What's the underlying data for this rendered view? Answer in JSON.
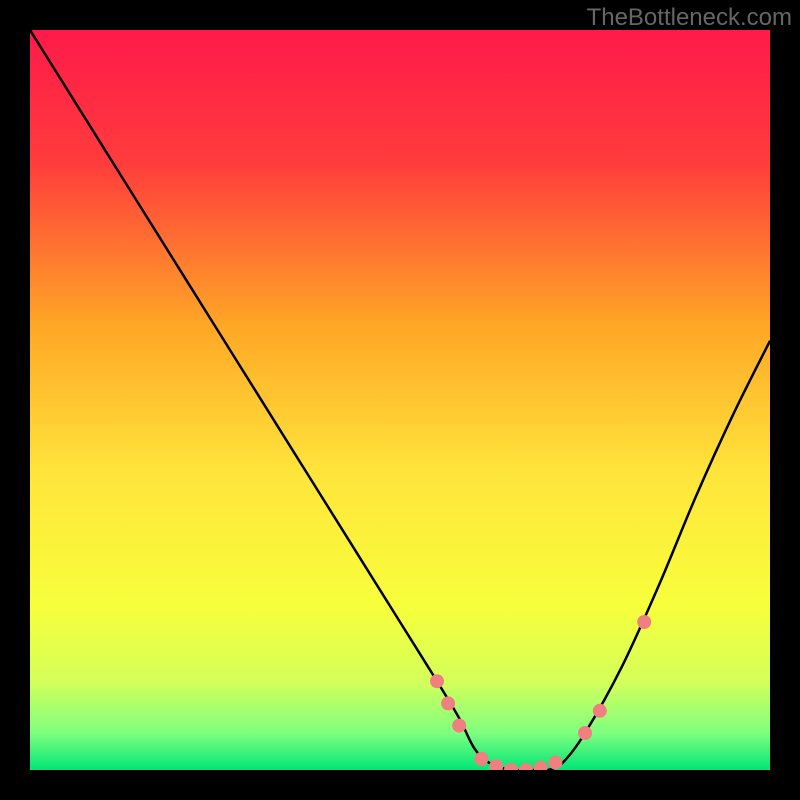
{
  "watermark": "TheBottleneck.com",
  "chart_data": {
    "type": "line",
    "title": "",
    "xlabel": "",
    "ylabel": "",
    "xlim": [
      0,
      100
    ],
    "ylim": [
      0,
      100
    ],
    "background_gradient": {
      "stops": [
        {
          "offset": 0,
          "color": "#ff1a4a"
        },
        {
          "offset": 18,
          "color": "#ff3c3c"
        },
        {
          "offset": 40,
          "color": "#ffa726"
        },
        {
          "offset": 60,
          "color": "#ffe53b"
        },
        {
          "offset": 78,
          "color": "#f7ff3b"
        },
        {
          "offset": 88,
          "color": "#d4ff5a"
        },
        {
          "offset": 95,
          "color": "#7fff7f"
        },
        {
          "offset": 100,
          "color": "#00e676"
        }
      ]
    },
    "series": [
      {
        "name": "bottleneck-curve",
        "x": [
          0,
          5,
          10,
          15,
          20,
          25,
          30,
          35,
          40,
          45,
          50,
          55,
          58,
          60,
          62,
          65,
          68,
          70,
          72,
          75,
          80,
          85,
          90,
          95,
          100
        ],
        "y": [
          100,
          92,
          84,
          76,
          68,
          60,
          52,
          44,
          36,
          28,
          20,
          12,
          7,
          3,
          1,
          0,
          0,
          0,
          1,
          5,
          14,
          25,
          37,
          48,
          58
        ]
      }
    ],
    "markers": {
      "name": "highlight-points",
      "color": "#f08080",
      "points": [
        {
          "x": 55,
          "y": 12
        },
        {
          "x": 56.5,
          "y": 9
        },
        {
          "x": 58,
          "y": 6
        },
        {
          "x": 61,
          "y": 1.5
        },
        {
          "x": 63,
          "y": 0.5
        },
        {
          "x": 65,
          "y": 0
        },
        {
          "x": 67,
          "y": 0
        },
        {
          "x": 69,
          "y": 0.3
        },
        {
          "x": 71,
          "y": 1
        },
        {
          "x": 75,
          "y": 5
        },
        {
          "x": 77,
          "y": 8
        },
        {
          "x": 83,
          "y": 20
        }
      ]
    }
  }
}
